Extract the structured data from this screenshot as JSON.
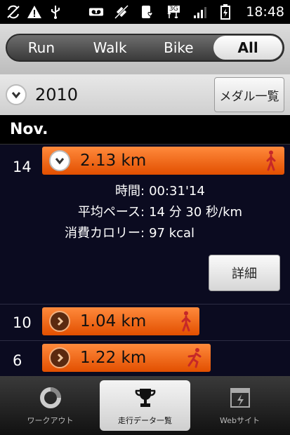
{
  "status": {
    "time": "18:48",
    "network": "3G"
  },
  "filter": {
    "options": [
      "Run",
      "Walk",
      "Bike",
      "All"
    ],
    "selected": "All"
  },
  "year_header": {
    "year": "2010",
    "medal_button": "メダル一覧"
  },
  "month": "Nov.",
  "entries": [
    {
      "day": "14",
      "distance": "2.13 km",
      "expanded": true,
      "activity_icon": "walk-icon",
      "details": [
        {
          "label": "時間",
          "value": "00:31'14"
        },
        {
          "label": "平均ペース",
          "value": "14 分 30 秒/km"
        },
        {
          "label": "消費カロリー",
          "value": "97 kcal"
        }
      ],
      "detail_button": "詳細"
    },
    {
      "day": "10",
      "distance": "1.04 km",
      "expanded": false,
      "activity_icon": "walk-icon"
    },
    {
      "day": "6",
      "distance": "1.22 km",
      "expanded": false,
      "activity_icon": "run-icon"
    }
  ],
  "bottom_tabs": [
    {
      "label": "ワークアウト",
      "icon": "workout-ring-icon"
    },
    {
      "label": "走行データ一覧",
      "icon": "trophy-icon",
      "active": true
    },
    {
      "label": "Webサイト",
      "icon": "web-icon"
    }
  ],
  "colors": {
    "accent": "#f06a1a",
    "list_bg": "#0b0b20"
  }
}
